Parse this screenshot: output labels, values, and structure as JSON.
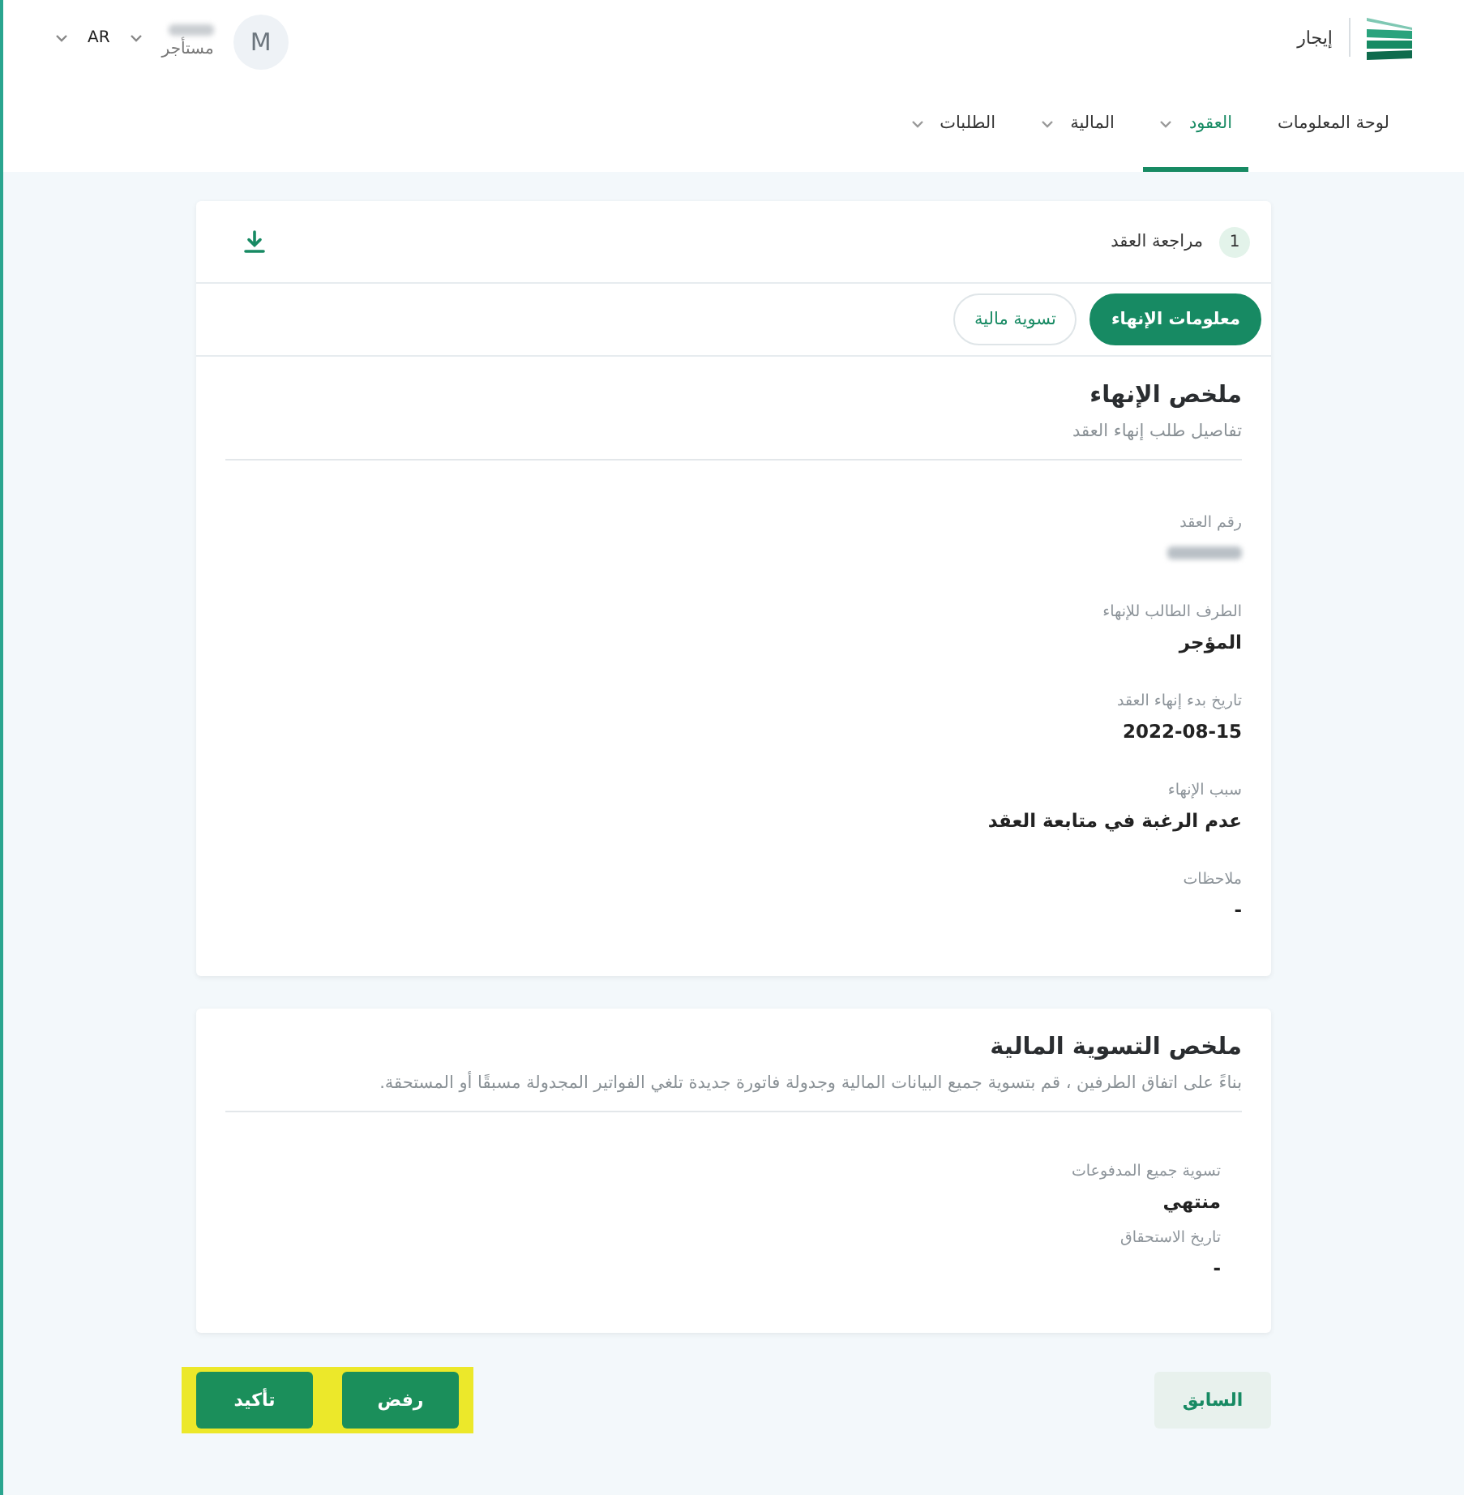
{
  "header": {
    "brand": "إيجار",
    "user": {
      "avatar_letter": "M",
      "name_redacted": true,
      "role": "مستأجر",
      "dropdown": true
    },
    "language": {
      "label": "AR",
      "dropdown": true
    }
  },
  "nav": [
    {
      "label": "لوحة المعلومات",
      "selected": false,
      "dropdown": false
    },
    {
      "label": "العقود",
      "selected": true,
      "dropdown": true
    },
    {
      "label": "المالية",
      "selected": false,
      "dropdown": true
    },
    {
      "label": "الطلبات",
      "selected": false,
      "dropdown": true
    }
  ],
  "step": {
    "number": "1",
    "title": "مراجعة العقد"
  },
  "tabs": [
    {
      "label": "معلومات الإنهاء",
      "selected": true
    },
    {
      "label": "تسوية مالية",
      "selected": false
    }
  ],
  "termination_summary": {
    "title": "ملخص الإنهاء",
    "subtitle": "تفاصيل طلب إنهاء العقد",
    "fields": [
      {
        "label": "رقم العقد",
        "redacted": true
      },
      {
        "label": "الطرف الطالب للإنهاء",
        "value": "المؤجر"
      },
      {
        "label": "تاريخ بدء إنهاء العقد",
        "value": "2022-08-15"
      },
      {
        "label": "سبب الإنهاء",
        "value": "عدم الرغبة في متابعة العقد"
      },
      {
        "label": "ملاحظات",
        "value": "-"
      }
    ]
  },
  "financial_summary": {
    "title": "ملخص التسوية المالية",
    "subtitle": "بناءً على اتفاق الطرفين ، قم بتسوية جميع البيانات المالية وجدولة فاتورة جديدة تلغي الفواتير المجدولة مسبقًا أو المستحقة.",
    "fields": [
      {
        "label": "تسوية جميع المدفوعات",
        "value": "منتهي"
      },
      {
        "label": "تاريخ الاستحقاق",
        "value": "-"
      }
    ]
  },
  "actions": [
    {
      "label": "السابق",
      "kind": "secondary",
      "highlighted": false
    },
    {
      "label": "رفض",
      "kind": "primary",
      "highlighted": true
    },
    {
      "label": "تأكيد",
      "kind": "primary",
      "highlighted": true
    }
  ]
}
